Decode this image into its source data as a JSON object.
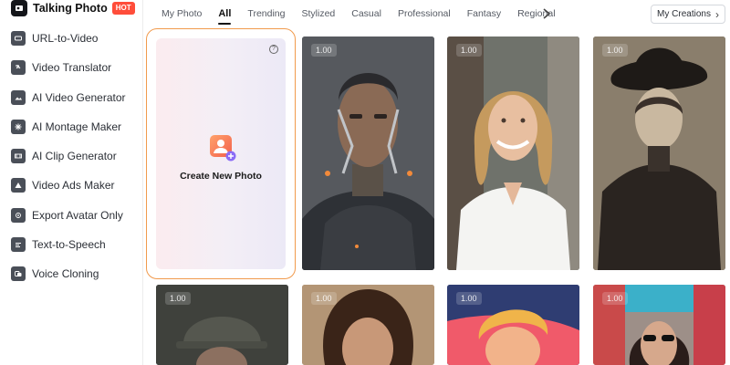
{
  "sidebar": {
    "active_item": {
      "label": "Talking Photo",
      "badge": "HOT",
      "icon": "talking-photo-icon"
    },
    "items": [
      {
        "label": "URL-to-Video",
        "icon": "url-icon"
      },
      {
        "label": "Video Translator",
        "icon": "translate-icon"
      },
      {
        "label": "AI Video Generator",
        "icon": "image-video-icon"
      },
      {
        "label": "AI Montage Maker",
        "icon": "montage-icon"
      },
      {
        "label": "AI Clip Generator",
        "icon": "clip-icon"
      },
      {
        "label": "Video Ads Maker",
        "icon": "ads-icon"
      },
      {
        "label": "Export Avatar Only",
        "icon": "avatar-export-icon"
      },
      {
        "label": "Text-to-Speech",
        "icon": "text-speech-icon"
      },
      {
        "label": "Voice Cloning",
        "icon": "voice-clone-icon"
      }
    ]
  },
  "tabs": {
    "items": [
      "My Photo",
      "All",
      "Trending",
      "Stylized",
      "Casual",
      "Professional",
      "Fantasy",
      "Regional"
    ],
    "active": "All"
  },
  "header": {
    "my_creations_label": "My Creations"
  },
  "create_card": {
    "label": "Create New Photo",
    "help": "?"
  },
  "photos": [
    {
      "duration": "1.00",
      "subject": "cyborg man"
    },
    {
      "duration": "1.00",
      "subject": "smiling woman white shirt"
    },
    {
      "duration": "1.00",
      "subject": "vintage sepia woman"
    },
    {
      "duration": "1.00",
      "subject": "man in helmet"
    },
    {
      "duration": "1.00",
      "subject": "curly haired woman"
    },
    {
      "duration": "1.00",
      "subject": "cartoon boy"
    },
    {
      "duration": "1.00",
      "subject": "woman with sunglasses"
    }
  ],
  "colors": {
    "accent_border": "#f19a4c",
    "hot_badge": "#ff4d3a",
    "active_tab": "#111111"
  }
}
